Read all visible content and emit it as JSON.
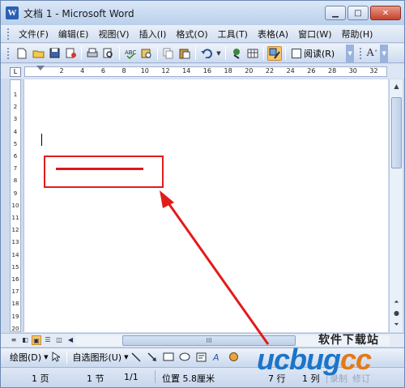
{
  "window": {
    "title": "文档 1 - Microsoft Word",
    "app_icon_letter": "W"
  },
  "menu": [
    "文件(F)",
    "编辑(E)",
    "视图(V)",
    "插入(I)",
    "格式(O)",
    "工具(T)",
    "表格(A)",
    "窗口(W)",
    "帮助(H)"
  ],
  "toolbar": {
    "read_label": "阅读(R)",
    "font_size_label": "A"
  },
  "ruler": {
    "corner": "L",
    "h_ticks": [
      "2",
      "4",
      "6",
      "8",
      "10",
      "12",
      "14",
      "16",
      "18",
      "20",
      "22",
      "24",
      "26",
      "28",
      "30",
      "32"
    ],
    "v_ticks": [
      "1",
      "2",
      "3",
      "4",
      "5",
      "6",
      "7",
      "8",
      "9",
      "10",
      "11",
      "12",
      "13",
      "14",
      "15",
      "16",
      "17",
      "18",
      "19",
      "20"
    ]
  },
  "hscroll_grip": "III",
  "drawbar": {
    "draw_label": "绘图(D)",
    "autoshape_label": "自选图形(U)"
  },
  "status": {
    "page": "1 页",
    "section": "1 节",
    "page_of": "1/1",
    "position": "位置 5.8厘米",
    "line": "7 行",
    "column": "1 列",
    "record": "录制",
    "revise": "修订"
  },
  "watermark": {
    "chinese": "软件下载站",
    "logo_main": "ucbug",
    "logo_tail": "cc"
  },
  "colors": {
    "annotation_red": "#e21b1b",
    "logo_blue": "#1b75c9",
    "logo_orange": "#e37a16"
  }
}
